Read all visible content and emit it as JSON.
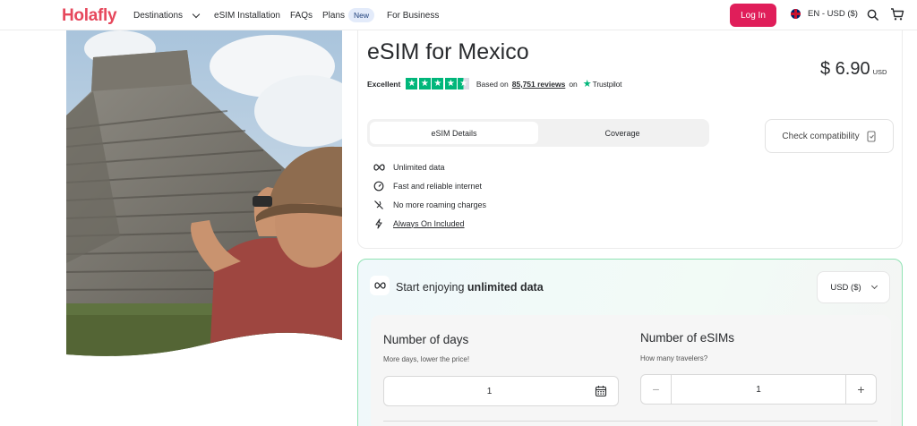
{
  "header": {
    "logo": "Holafly",
    "nav": {
      "destinations": "Destinations",
      "esim_installation": "eSIM Installation",
      "faqs": "FAQs",
      "plans": "Plans",
      "plans_badge": "New",
      "for_business": "For Business"
    },
    "login_label": "Log In",
    "language": "EN - USD ($)"
  },
  "product": {
    "title": "eSIM for Mexico",
    "rating_word": "Excellent",
    "rating_stars": 4.5,
    "based_on": "Based on",
    "reviews": "85,751 reviews",
    "on": "on",
    "trustpilot": "Trustpilot",
    "price": "$ 6.90",
    "currency": "USD",
    "tabs": [
      "eSIM Details",
      "Coverage"
    ],
    "check_compat": "Check compatibility",
    "features": [
      {
        "icon": "infinity-icon",
        "text": "Unlimited data"
      },
      {
        "icon": "speedometer-icon",
        "text": "Fast and reliable internet"
      },
      {
        "icon": "no-roaming-icon",
        "text": "No more roaming charges"
      },
      {
        "icon": "lightning-icon",
        "text": "Always On Included"
      }
    ]
  },
  "plan": {
    "heading_prefix": "Start enjoying ",
    "heading_bold": "unlimited data",
    "currency_select": "USD ($)",
    "days_label": "Number of days",
    "days_hint": "More days, lower the price!",
    "days_value": "1",
    "sims_label": "Number of eSIMs",
    "sims_hint": "How many travelers?",
    "sims_value": "1",
    "minus": "−",
    "plus": "+"
  },
  "colors": {
    "brand": "#e6485c",
    "login": "#e01e5a",
    "trustpilot": "#00b67a",
    "plan_border": "#8fe3b3"
  }
}
